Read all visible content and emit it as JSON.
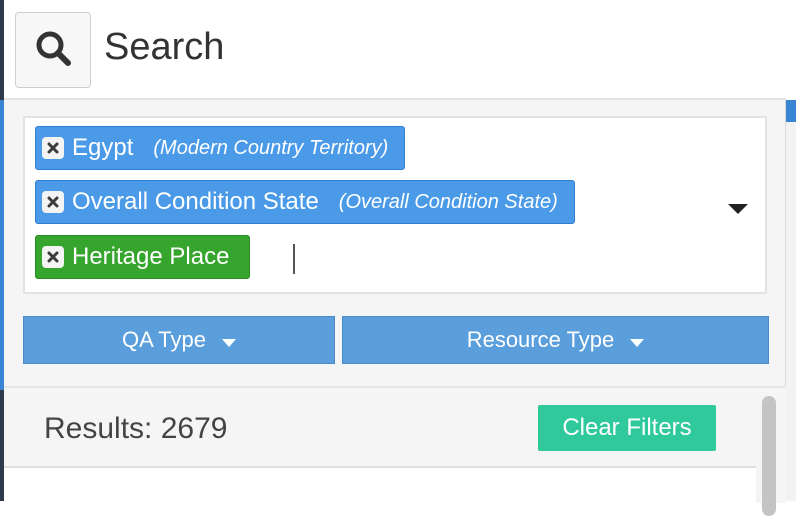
{
  "search": {
    "label": "Search",
    "icon": "search-icon"
  },
  "tags": [
    {
      "label": "Egypt",
      "context": "(Modern Country Territory)",
      "color": "#4a9ae8"
    },
    {
      "label": "Overall Condition State",
      "context": "(Overall Condition State)",
      "color": "#4a9ae8"
    },
    {
      "label": "Heritage Place",
      "color": "#36a52d"
    }
  ],
  "filters": {
    "qa_type_label": "QA Type",
    "resource_type_label": "Resource Type",
    "button_color": "#5b9edc"
  },
  "results": {
    "count_label": "Results: 2679",
    "clear_filters_label": "Clear Filters",
    "clear_filters_color": "#2fc99b"
  }
}
